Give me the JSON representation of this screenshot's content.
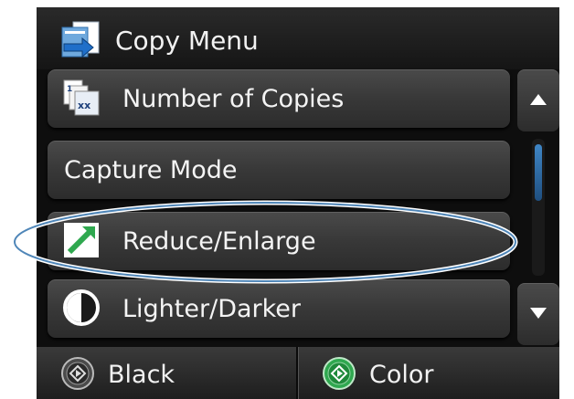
{
  "header": {
    "title": "Copy Menu",
    "icon": "copy-menu-icon"
  },
  "menu": {
    "items": [
      {
        "label": "Number of Copies",
        "icon": "number-of-copies-icon"
      },
      {
        "label": "Capture Mode"
      },
      {
        "label": "Reduce/Enlarge",
        "icon": "reduce-enlarge-icon",
        "highlighted": true
      },
      {
        "label": "Lighter/Darker",
        "icon": "lighter-darker-icon"
      }
    ]
  },
  "scrollbar": {
    "up_icon": "triangle-up-icon",
    "down_icon": "triangle-down-icon"
  },
  "footer": {
    "black_label": "Black",
    "color_label": "Color"
  },
  "colors": {
    "background": "#0e0e0e",
    "button": "#3a3a3a",
    "text": "#f4f4f4",
    "accent_blue": "#3f86c6",
    "start_green": "#2fa84f",
    "highlight_outline": "#4f86b8"
  }
}
